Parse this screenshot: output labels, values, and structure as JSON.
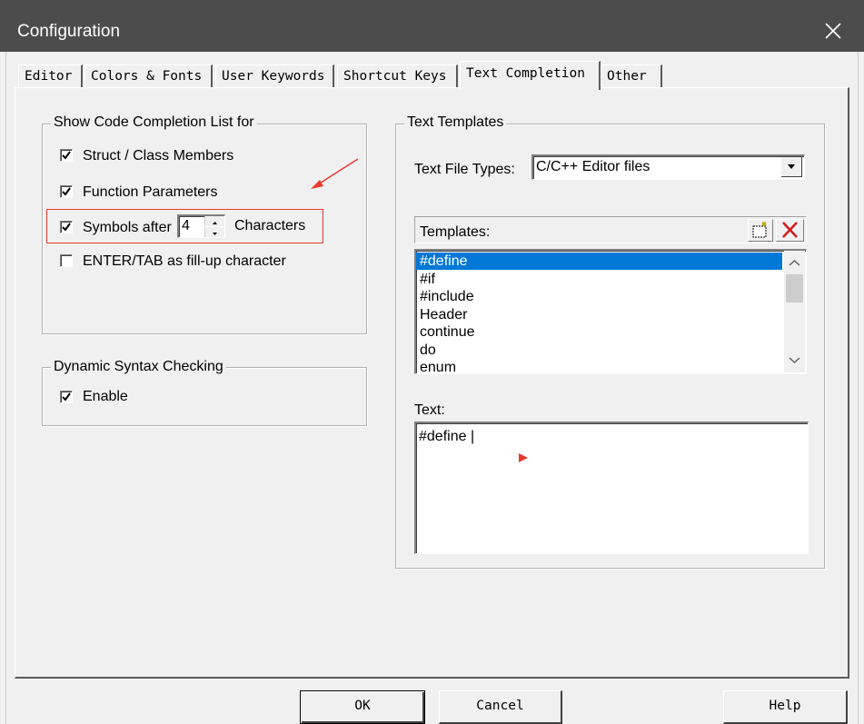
{
  "window": {
    "title": "Configuration"
  },
  "tabs": [
    {
      "label": "Editor"
    },
    {
      "label": "Colors & Fonts"
    },
    {
      "label": "User Keywords"
    },
    {
      "label": "Shortcut Keys"
    },
    {
      "label": "Text Completion"
    },
    {
      "label": "Other"
    }
  ],
  "code_completion": {
    "group_label": "Show Code Completion List for",
    "struct_members": {
      "label": "Struct / Class Members",
      "checked": true
    },
    "function_params": {
      "label": "Function Parameters",
      "checked": true
    },
    "symbols_after": {
      "label": "Symbols after",
      "value": "4",
      "suffix": "Characters",
      "checked": true
    },
    "enter_tab": {
      "label": "ENTER/TAB as fill-up character",
      "checked": false
    }
  },
  "syntax_checking": {
    "group_label": "Dynamic Syntax Checking",
    "enable": {
      "label": "Enable",
      "checked": true
    }
  },
  "text_templates": {
    "group_label": "Text Templates",
    "file_types_label": "Text File Types:",
    "file_types_value": "C/C++ Editor files",
    "templates_label": "Templates:",
    "templates": [
      "#define",
      "#if",
      "#include",
      "Header",
      "continue",
      "do",
      "enum"
    ],
    "selected_index": 0,
    "text_label": "Text:",
    "text_value": "#define |"
  },
  "buttons": {
    "ok": "OK",
    "cancel": "Cancel",
    "help": "Help"
  },
  "colors": {
    "annotation": "#e8392d",
    "selection": "#0078d7",
    "titlebar": "#4c4c4c"
  }
}
